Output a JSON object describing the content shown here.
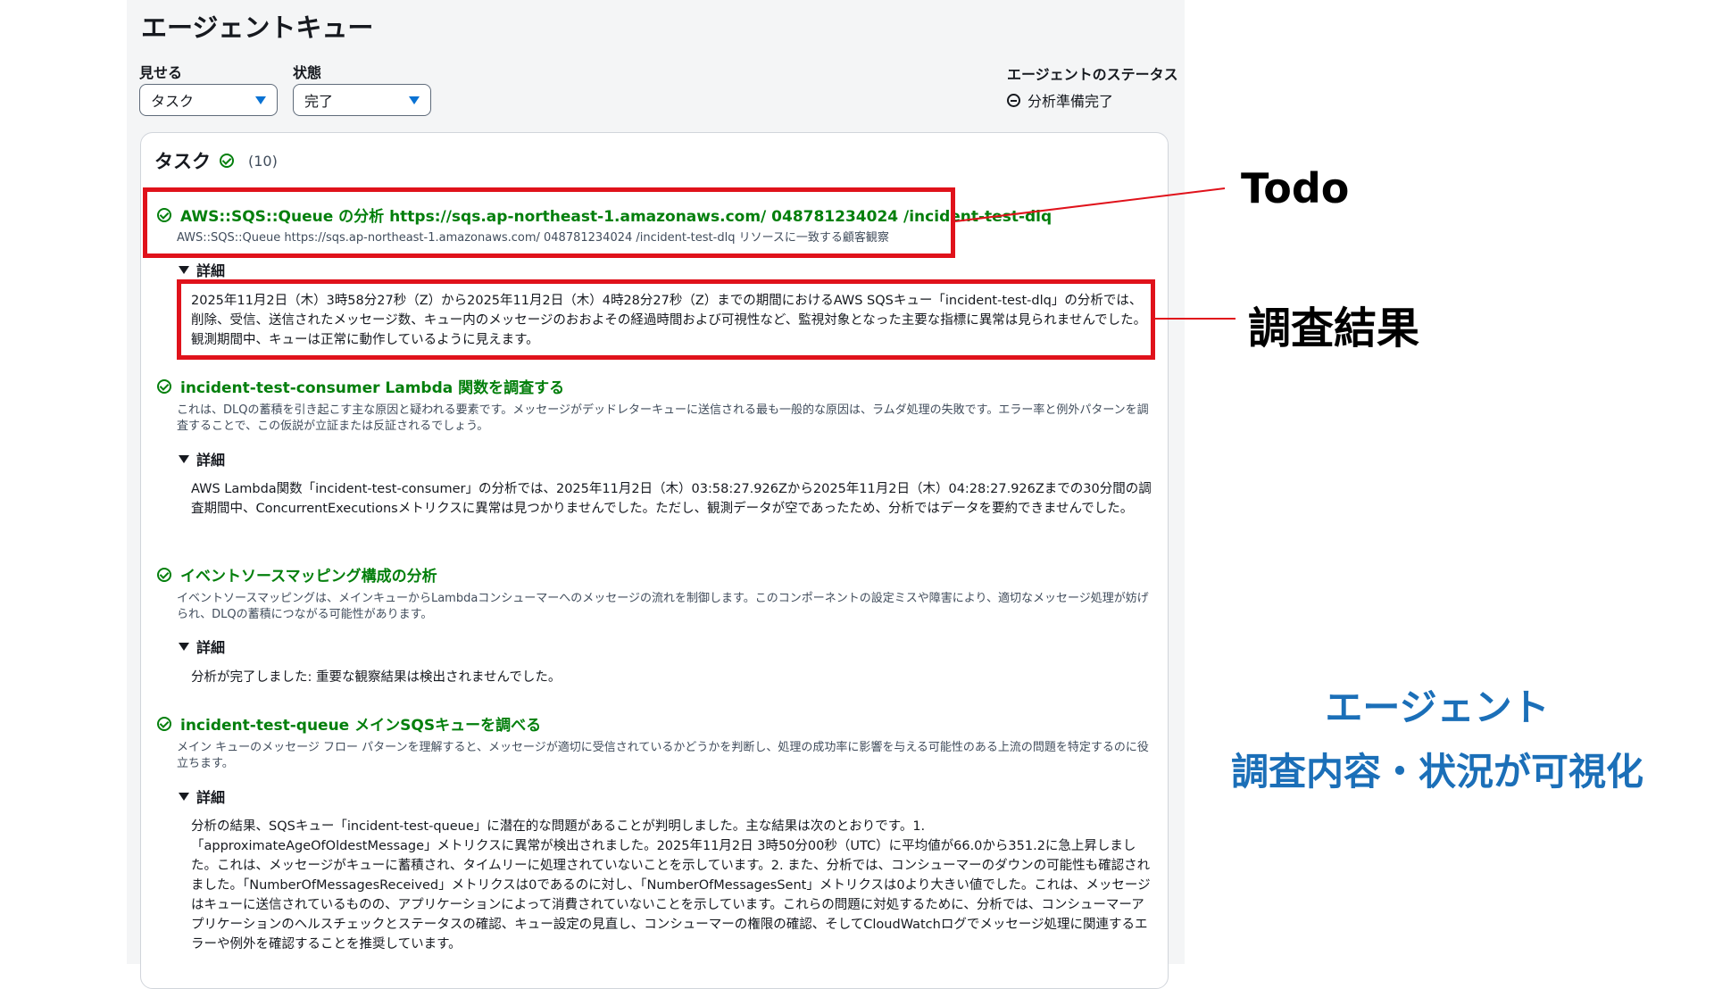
{
  "page": {
    "title": "エージェントキュー"
  },
  "filters": {
    "show_label": "見せる",
    "show_value": "タスク",
    "state_label": "状態",
    "state_value": "完了"
  },
  "agent_status": {
    "label": "エージェントのステータス",
    "value": "分析準備完了"
  },
  "tasks_panel": {
    "title": "タスク",
    "count": "(10)",
    "detail_label": "詳細",
    "tasks": [
      {
        "title": "AWS::SQS::Queue の分析 https://sqs.ap-northeast-1.amazonaws.com/ 048781234024 /incident-test-dlq",
        "description": "AWS::SQS::Queue https://sqs.ap-northeast-1.amazonaws.com/ 048781234024 /incident-test-dlq リソースに一致する顧客観察",
        "detail": "2025年11月2日（木）3時58分27秒（Z）から2025年11月2日（木）4時28分27秒（Z）までの期間におけるAWS SQSキュー「incident-test-dlq」の分析では、削除、受信、送信されたメッセージ数、キュー内のメッセージのおおよその経過時間および可視性など、監視対象となった主要な指標に異常は見られませんでした。観測期間中、キューは正常に動作しているように見えます。"
      },
      {
        "title": "incident-test-consumer Lambda 関数を調査する",
        "description": "これは、DLQの蓄積を引き起こす主な原因と疑われる要素です。メッセージがデッドレターキューに送信される最も一般的な原因は、ラムダ処理の失敗です。エラー率と例外パターンを調査することで、この仮説が立証または反証されるでしょう。",
        "detail": "AWS Lambda関数「incident-test-consumer」の分析では、2025年11月2日（木）03:58:27.926Zから2025年11月2日（木）04:28:27.926Zまでの30分間の調査期間中、ConcurrentExecutionsメトリクスに異常は見つかりませんでした。ただし、観測データが空であったため、分析ではデータを要約できませんでした。"
      },
      {
        "title": "イベントソースマッピング構成の分析",
        "description": "イベントソースマッピングは、メインキューからLambdaコンシューマーへのメッセージの流れを制御します。このコンポーネントの設定ミスや障害により、適切なメッセージ処理が妨げられ、DLQの蓄積につながる可能性があります。",
        "detail": "分析が完了しました: 重要な観察結果は検出されませんでした。"
      },
      {
        "title": "incident-test-queue メインSQSキューを調べる",
        "description": "メイン キューのメッセージ フロー パターンを理解すると、メッセージが適切に受信されているかどうかを判断し、処理の成功率に影響を与える可能性のある上流の問題を特定するのに役立ちます。",
        "detail": "分析の結果、SQSキュー「incident-test-queue」に潜在的な問題があることが判明しました。主な結果は次のとおりです。1.「approximateAgeOfOldestMessage」メトリクスに異常が検出されました。2025年11月2日 3時50分00秒（UTC）に平均値が66.0から351.2に急上昇しました。これは、メッセージがキューに蓄積され、タイムリーに処理されていないことを示しています。2. また、分析では、コンシューマーのダウンの可能性も確認されました。「NumberOfMessagesReceived」メトリクスは0であるのに対し、「NumberOfMessagesSent」メトリクスは0より大きい値でした。これは、メッセージはキューに送信されているものの、アプリケーションによって消費されていないことを示しています。これらの問題に対処するために、分析では、コンシューマーアプリケーションのヘルスチェックとステータスの確認、キュー設定の見直し、コンシューマーの権限の確認、そしてCloudWatchログでメッセージ処理に関連するエラーや例外を確認することを推奨しています。"
      }
    ]
  },
  "annotations": {
    "todo": "Todo",
    "result": "調査結果",
    "note_line1": "エージェント",
    "note_line2": "調査内容・状況が可視化",
    "highlight_color": "#e0121b",
    "note_color": "#1b6fb8"
  }
}
